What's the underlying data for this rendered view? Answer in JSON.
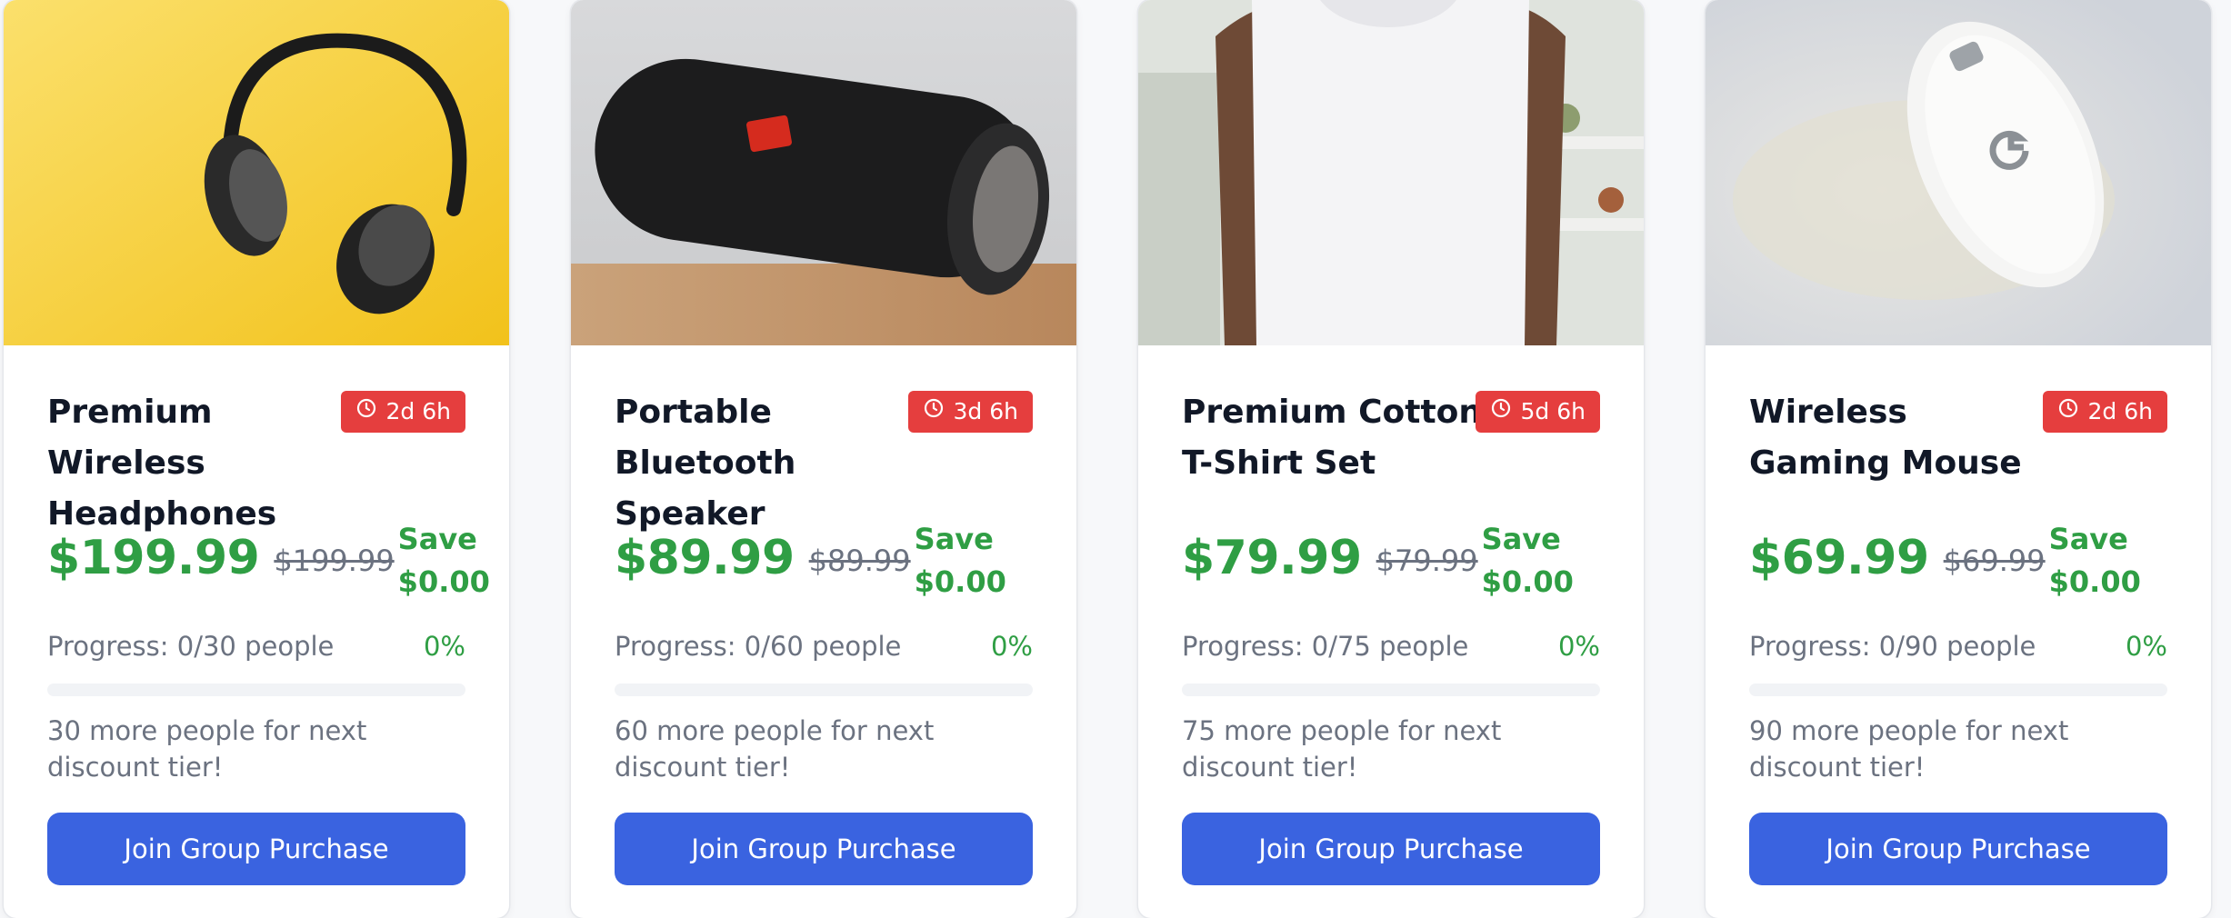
{
  "products": [
    {
      "name": "Premium Wireless Headphones",
      "timer": "2d 6h",
      "price": "$199.99",
      "original_price": "$199.99",
      "save_label": "Save",
      "save_amount": "$0.00",
      "progress_label": "Progress: 0/30 people",
      "progress_percent": "0%",
      "progress_fraction": 0,
      "hint": "30 more people for next discount tier!",
      "button": "Join Group Purchase",
      "image": "headphones-photo"
    },
    {
      "name": "Portable Bluetooth Speaker",
      "timer": "3d 6h",
      "price": "$89.99",
      "original_price": "$89.99",
      "save_label": "Save",
      "save_amount": "$0.00",
      "progress_label": "Progress: 0/60 people",
      "progress_percent": "0%",
      "progress_fraction": 0,
      "hint": "60 more people for next discount tier!",
      "button": "Join Group Purchase",
      "image": "speaker-photo"
    },
    {
      "name": "Premium Cotton T-Shirt Set",
      "timer": "5d 6h",
      "price": "$79.99",
      "original_price": "$79.99",
      "save_label": "Save",
      "save_amount": "$0.00",
      "progress_label": "Progress: 0/75 people",
      "progress_percent": "0%",
      "progress_fraction": 0,
      "hint": "75 more people for next discount tier!",
      "button": "Join Group Purchase",
      "image": "tshirt-photo"
    },
    {
      "name": "Wireless Gaming Mouse",
      "timer": "2d 6h",
      "price": "$69.99",
      "original_price": "$69.99",
      "save_label": "Save",
      "save_amount": "$0.00",
      "progress_label": "Progress: 0/90 people",
      "progress_percent": "0%",
      "progress_fraction": 0,
      "hint": "90 more people for next discount tier!",
      "button": "Join Group Purchase",
      "image": "mouse-photo"
    }
  ],
  "colors": {
    "accent_green": "#2f9e44",
    "timer_red": "#e53e3e",
    "button_blue": "#3a63e0",
    "text_dark": "#111827",
    "text_muted": "#6b7280"
  },
  "icons": {
    "timer": "clock-icon"
  }
}
